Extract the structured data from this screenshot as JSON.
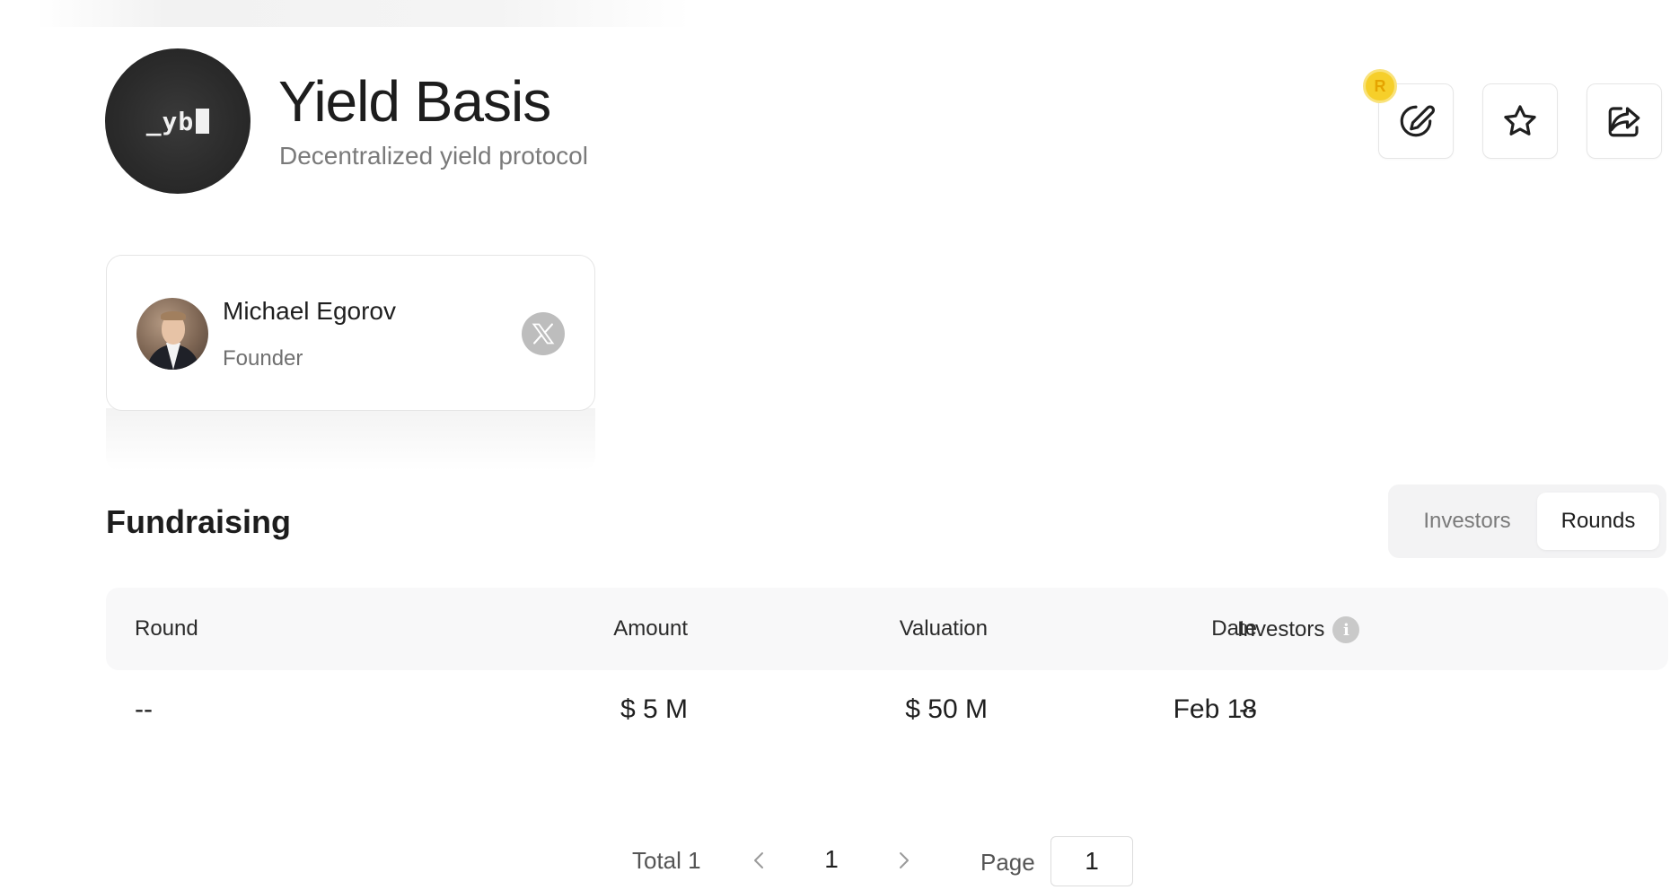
{
  "project": {
    "logo_text": "_yb",
    "title": "Yield Basis",
    "subtitle": "Decentralized yield protocol"
  },
  "actions": {
    "reward_badge": "R",
    "edit_icon": "edit-icon",
    "star_icon": "star-icon",
    "share_icon": "share-icon"
  },
  "founder": {
    "name": "Michael Egorov",
    "role": "Founder",
    "social_icon": "x-logo-icon"
  },
  "fundraising": {
    "title": "Fundraising",
    "tabs": [
      {
        "label": "Investors",
        "active": false
      },
      {
        "label": "Rounds",
        "active": true
      }
    ],
    "columns": {
      "round": "Round",
      "amount": "Amount",
      "valuation": "Valuation",
      "date": "Date",
      "investors": "Investors"
    },
    "info_icon": "i",
    "rows": [
      {
        "round": "--",
        "amount": "$ 5 M",
        "valuation": "$ 50 M",
        "date": "Feb 18",
        "investors": "--"
      }
    ]
  },
  "pagination": {
    "total": "Total 1",
    "current": "1",
    "page_label": "Page",
    "page_input": "1"
  },
  "colors": {
    "accent_badge": "#f6cf2a",
    "header_bg": "#f8f8f9",
    "toggle_bg": "#f3f3f4"
  }
}
